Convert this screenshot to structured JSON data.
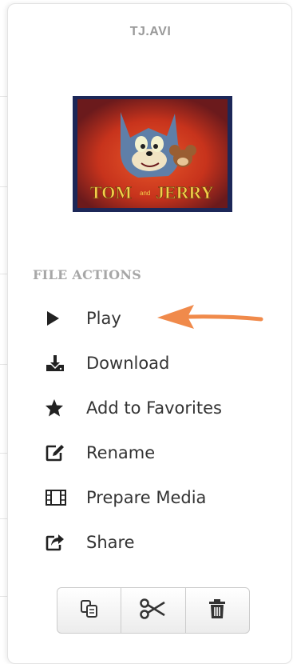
{
  "file": {
    "name": "TJ.AVI",
    "thumbnail_alt": "TOM and JERRY"
  },
  "actions": {
    "heading": "FILE ACTIONS",
    "items": [
      {
        "label": "Play",
        "icon": "play-icon"
      },
      {
        "label": "Download",
        "icon": "download-icon"
      },
      {
        "label": "Add to Favorites",
        "icon": "star-icon"
      },
      {
        "label": "Rename",
        "icon": "edit-icon"
      },
      {
        "label": "Prepare Media",
        "icon": "film-icon"
      },
      {
        "label": "Share",
        "icon": "share-icon"
      }
    ]
  },
  "toolbar": {
    "buttons": [
      {
        "icon": "copy-icon"
      },
      {
        "icon": "cut-icon"
      },
      {
        "icon": "trash-icon"
      }
    ]
  },
  "colors": {
    "arrow": "#f08a4b",
    "heading": "#a7a7a7",
    "text": "#333333"
  }
}
